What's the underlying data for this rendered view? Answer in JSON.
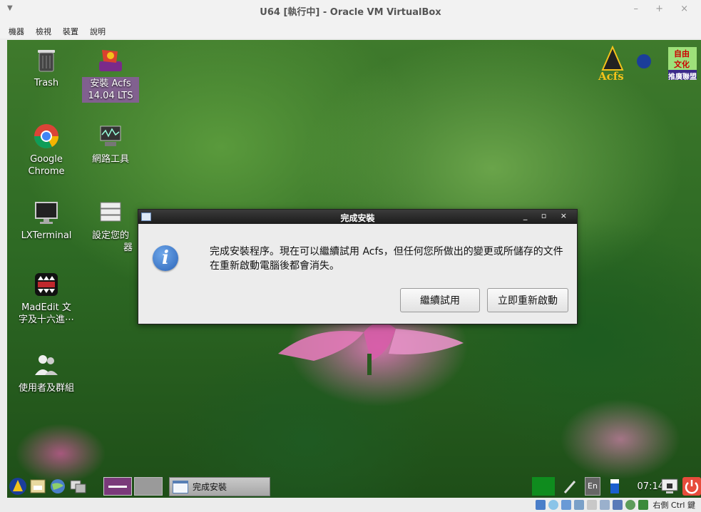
{
  "host": {
    "title": "U64 [執行中] - Oracle VM VirtualBox",
    "menu": [
      "機器",
      "檢視",
      "裝置",
      "說明"
    ],
    "window_controls": "– + ×",
    "status_text": "右側 Ctrl 鍵"
  },
  "desktop": {
    "icons": [
      {
        "label": "Trash",
        "icon": "trash-icon"
      },
      {
        "label": "安裝 Acfs 14.04 LTS",
        "icon": "installer-icon"
      },
      {
        "label": "Google Chrome",
        "icon": "chrome-icon"
      },
      {
        "label": "網路工具",
        "icon": "network-tools-icon"
      },
      {
        "label": "LXTerminal",
        "icon": "terminal-icon"
      },
      {
        "label": "設定您的",
        "label2": "器",
        "icon": "server-icon"
      },
      {
        "label": "MadEdit 文",
        "label2": "字及十六進⋯",
        "icon": "madedit-icon"
      },
      {
        "label": "使用者及群組",
        "icon": "users-groups-icon"
      }
    ],
    "logo_text": [
      "Acfs",
      "自由",
      "文化",
      "推廣聯盟"
    ]
  },
  "dialog": {
    "title": "完成安裝",
    "controls": "_ ▫ ×",
    "message": "完成安裝程序。現在可以繼續試用 Acfs，但任何您所做出的變更或所儲存的文件在重新啟動電腦後都會消失。",
    "continue_label": "繼續試用",
    "restart_label": "立即重新啟動"
  },
  "taskbar": {
    "window_label": "完成安裝",
    "clock": "07:14",
    "input_method": "En"
  },
  "colors": {
    "dialog_title_bg": "#2b2b2b",
    "info_icon": "#2a63b8",
    "selected_label": "#8c5aa0",
    "power_button": "#e74c3c"
  }
}
